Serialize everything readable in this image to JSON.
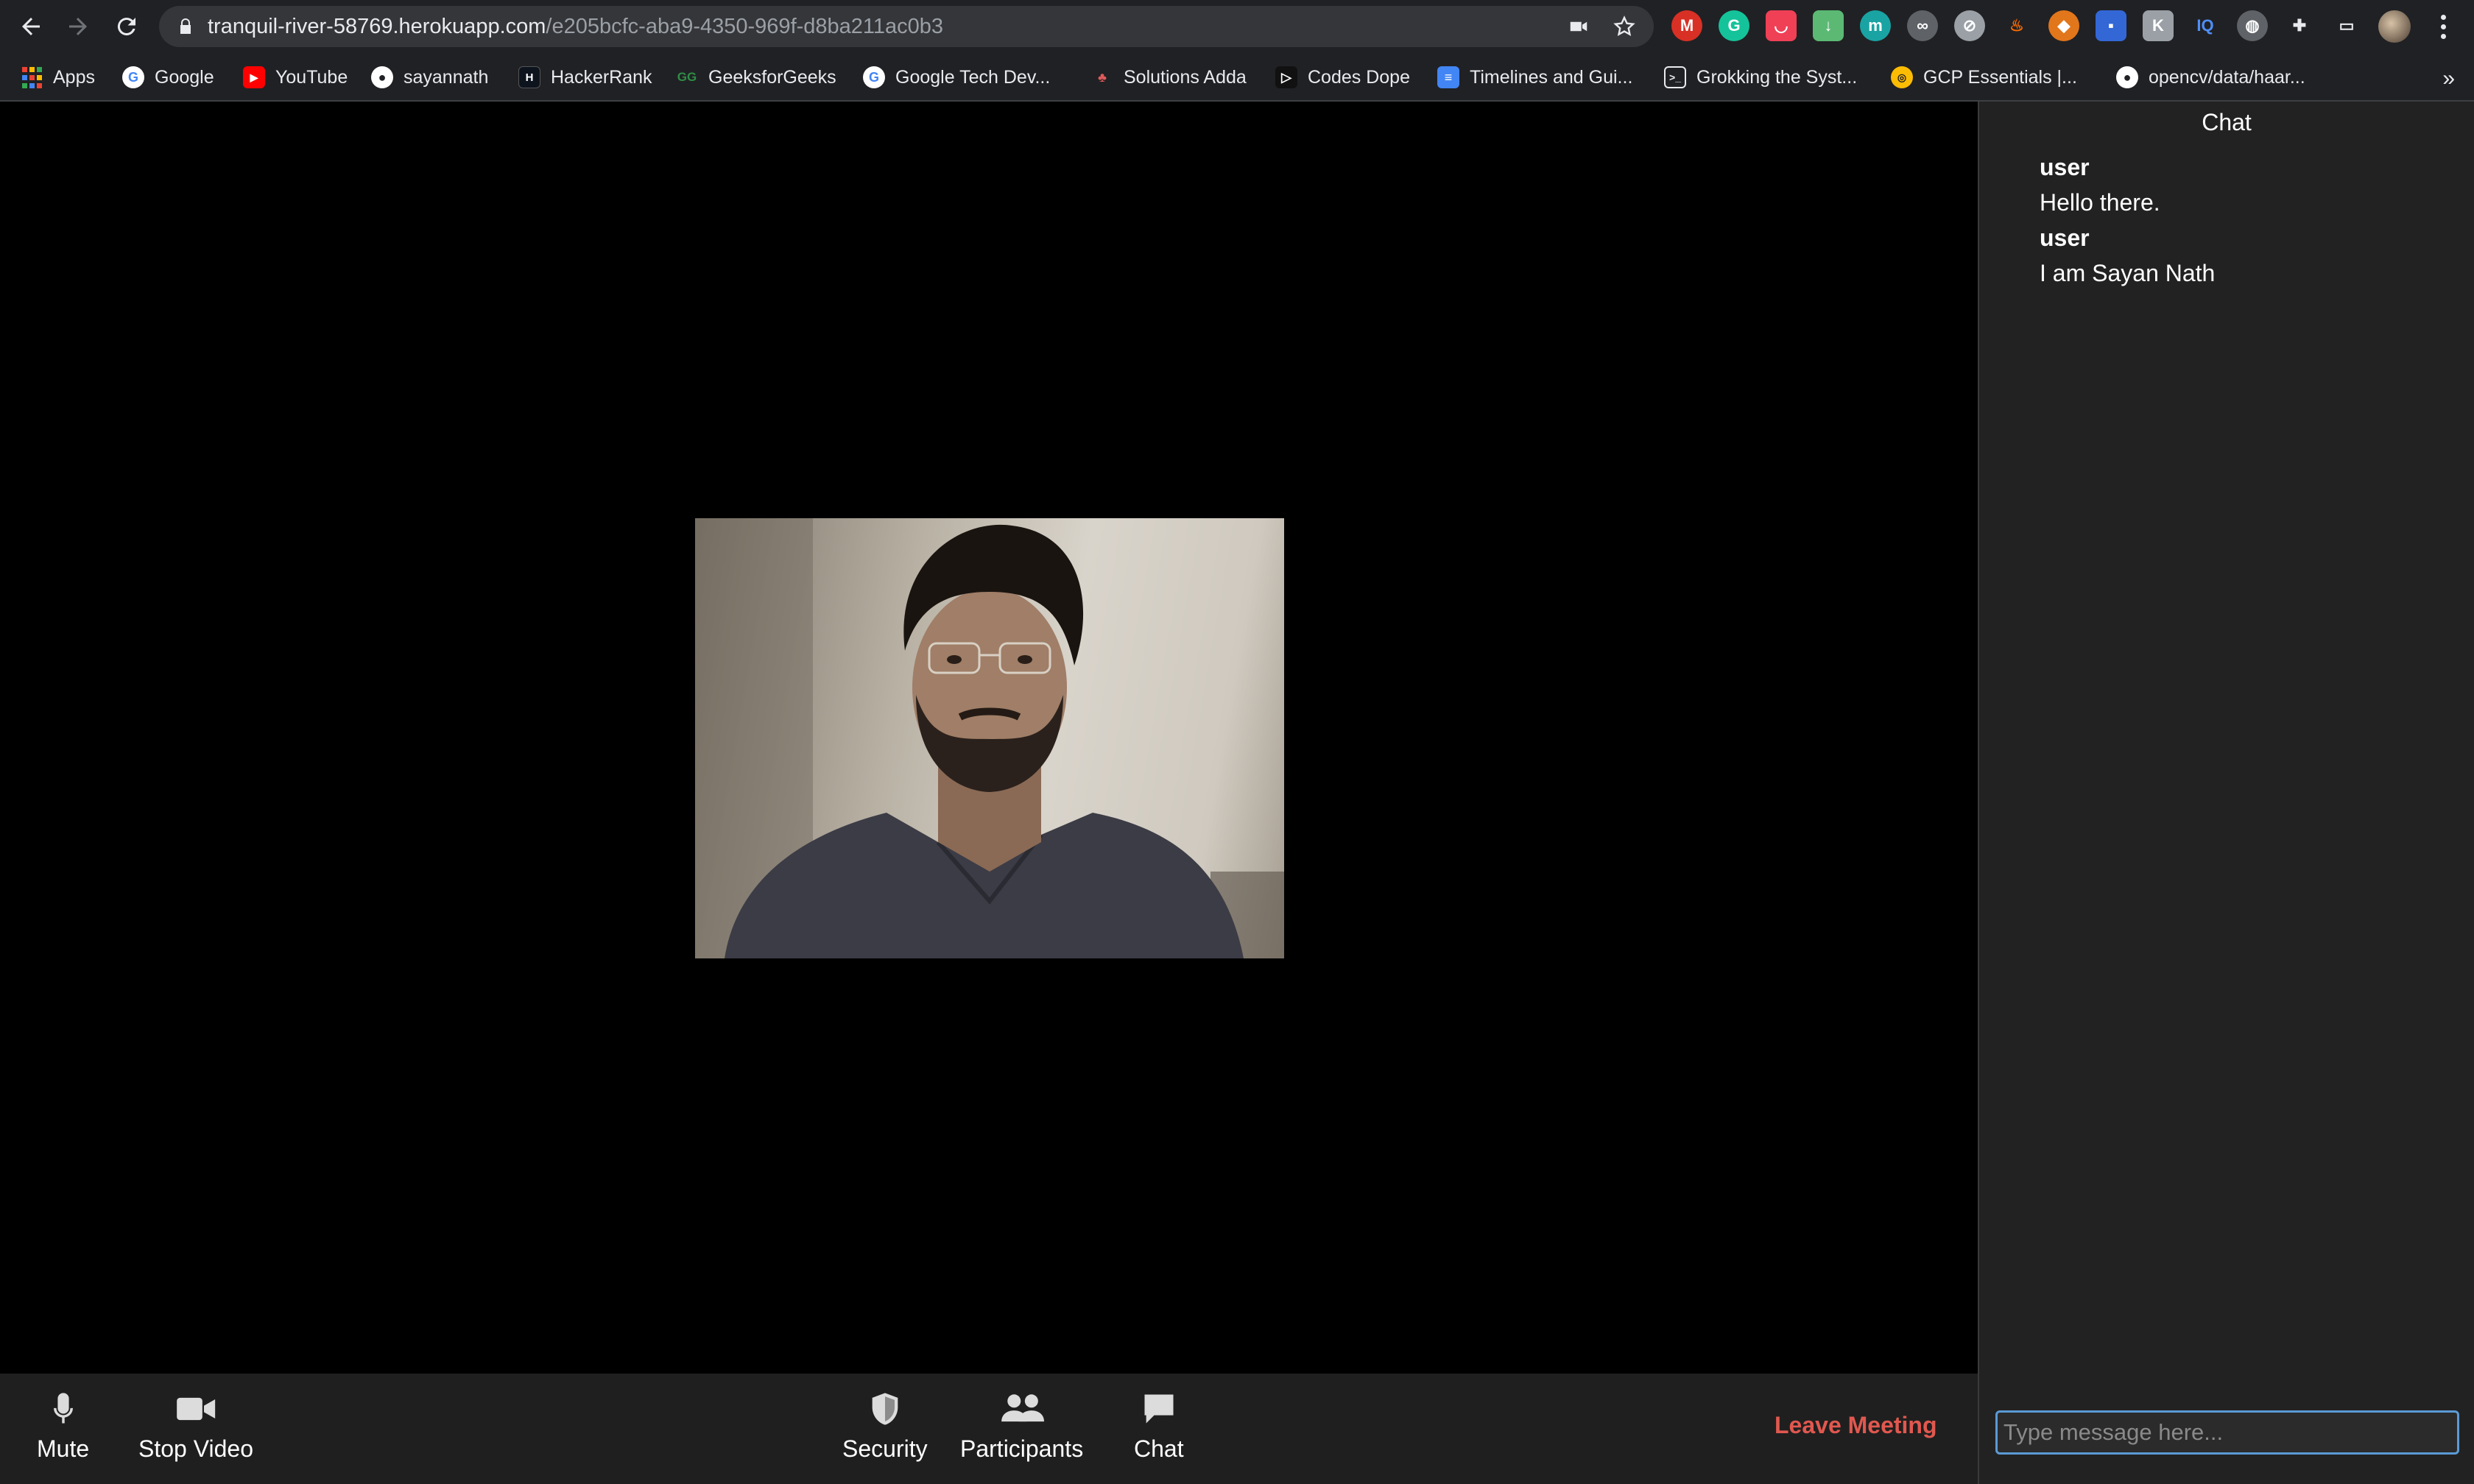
{
  "browser": {
    "url_host": "tranquil-river-58769.herokuapp.com",
    "url_path": "/e205bcfc-aba9-4350-969f-d8ba211ac0b3"
  },
  "bookmarks": [
    {
      "label": "Apps",
      "icon": "apps-grid-icon",
      "color": "#ea4335"
    },
    {
      "label": "Google",
      "icon": "google-icon",
      "color": "#ffffff"
    },
    {
      "label": "YouTube",
      "icon": "youtube-icon",
      "color": "#ff0000"
    },
    {
      "label": "sayannath",
      "icon": "github-icon",
      "color": "#ffffff"
    },
    {
      "label": "HackerRank",
      "icon": "hackerrank-icon",
      "color": "#1ba94c"
    },
    {
      "label": "GeeksforGeeks",
      "icon": "geeksforgeeks-icon",
      "color": "#2f8d46"
    },
    {
      "label": "Google Tech Dev...",
      "icon": "google-icon",
      "color": "#ffffff"
    },
    {
      "label": "Solutions Adda",
      "icon": "solutions-adda-icon",
      "color": "#e05a5a"
    },
    {
      "label": "Codes Dope",
      "icon": "codes-dope-icon",
      "color": "#ffffff"
    },
    {
      "label": "Timelines and Gui...",
      "icon": "google-docs-icon",
      "color": "#4285f4"
    },
    {
      "label": "Grokking the Syst...",
      "icon": "terminal-icon",
      "color": "#ffffff"
    },
    {
      "label": "GCP Essentials |...",
      "icon": "gcp-icon",
      "color": "#fbbc04"
    },
    {
      "label": "opencv/data/haar...",
      "icon": "github-icon",
      "color": "#ffffff"
    }
  ],
  "controls": {
    "mute": "Mute",
    "stop_video": "Stop Video",
    "security": "Security",
    "participants": "Participants",
    "chat": "Chat",
    "leave": "Leave Meeting"
  },
  "chat": {
    "title": "Chat",
    "messages": [
      {
        "author": "user",
        "text": "Hello there."
      },
      {
        "author": "user",
        "text": "I am Sayan Nath"
      }
    ],
    "input_placeholder": "Type message here..."
  },
  "colors": {
    "leave": "#e0584f",
    "input_focus": "#5b9bd5"
  }
}
